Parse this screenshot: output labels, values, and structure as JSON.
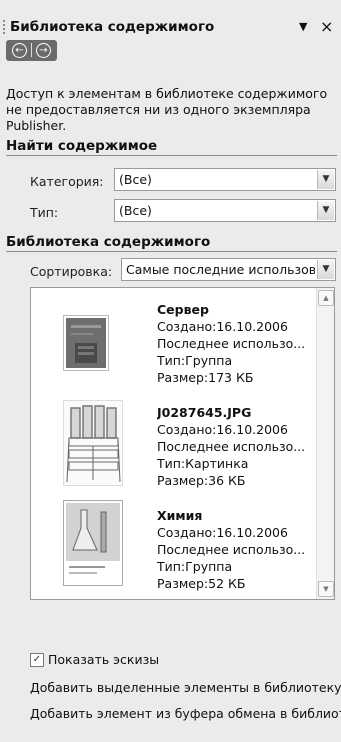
{
  "pane": {
    "title": "Библиотека содержимого",
    "dropdown_icon": "chevron-down-icon",
    "close_icon": "close-icon",
    "close_glyph": "×",
    "back_icon": "back-arrow-icon",
    "forward_icon": "forward-arrow-icon"
  },
  "info": {
    "line1": "Доступ к элементам в библиотеке содержимого",
    "line2": "не предоставляется ни из одного экземпляра",
    "line3": "Publisher."
  },
  "find": {
    "heading": "Найти содержимое",
    "category_label": "Категория:",
    "category_value": "(Все)",
    "type_label": "Тип:",
    "type_value": "(Все)"
  },
  "library": {
    "heading": "Библиотека содержимого",
    "sort_label": "Сортировка:",
    "sort_value": "Самые последние использова"
  },
  "items": [
    {
      "name": "Сервер",
      "created": "Создано:16.10.2006",
      "last_used": "Последнее использо...",
      "type": "Тип:Группа",
      "size": "Размер:173 КБ"
    },
    {
      "name": "J0287645.JPG",
      "created": "Создано:16.10.2006",
      "last_used": "Последнее использо...",
      "type": "Тип:Картинка",
      "size": "Размер:36 КБ"
    },
    {
      "name": "Химия",
      "created": "Создано:16.10.2006",
      "last_used": "Последнее использо...",
      "type": "Тип:Группа",
      "size": "Размер:52 КБ"
    }
  ],
  "options": {
    "show_thumbnails_label": "Показать эскизы",
    "show_thumbnails_checked": true,
    "add_selected": "Добавить выделенные элементы в библиотеку",
    "add_clipboard": "Добавить элемент из буфера обмена в библиотеку"
  },
  "colors": {
    "background": "#ebebeb",
    "nav_bar": "#6b6b6b"
  }
}
